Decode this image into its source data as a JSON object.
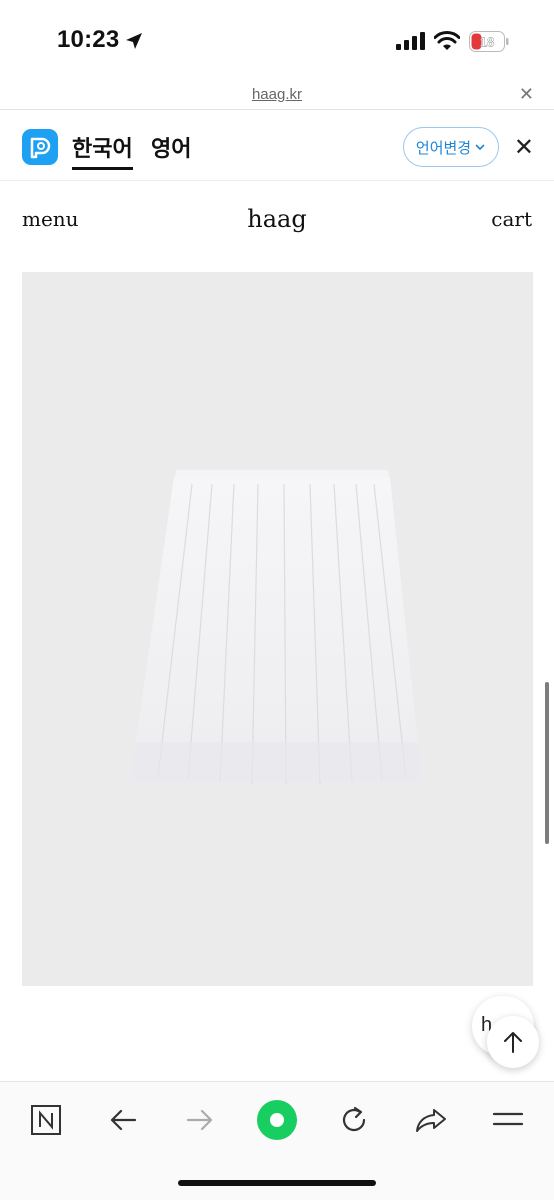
{
  "status_bar": {
    "time": "10:23",
    "battery_level": "18"
  },
  "url_bar": {
    "url": "haag.kr",
    "close_icon": "close-icon"
  },
  "translate_bar": {
    "tab_korean": "한국어",
    "tab_english": "영어",
    "change_language": "언어변경",
    "close_icon": "close-icon"
  },
  "site_header": {
    "menu": "menu",
    "logo": "haag",
    "cart": "cart"
  },
  "product": {
    "image_alt": "white pleated skirt"
  },
  "floating": {
    "chat_text": "h",
    "scroll_top_icon": "arrow-up-icon"
  },
  "toolbar": {
    "items": [
      "naver-icon",
      "back-icon",
      "forward-icon",
      "green-dot-icon",
      "reload-icon",
      "share-icon",
      "menu-icon"
    ],
    "accent_color": "#19ce60"
  }
}
